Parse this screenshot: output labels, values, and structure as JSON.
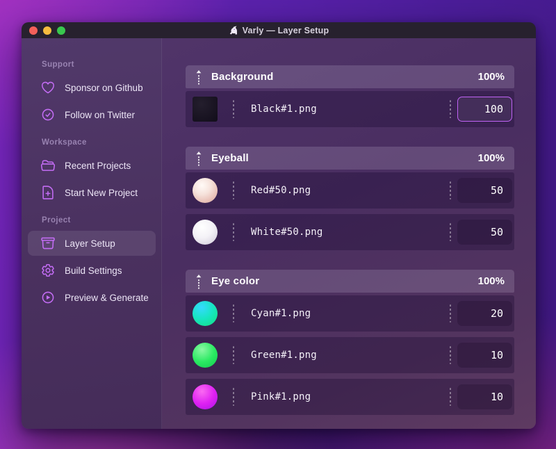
{
  "window": {
    "title": "Varly — Layer Setup"
  },
  "sidebar": {
    "sections": [
      {
        "label": "Support",
        "items": [
          {
            "label": "Sponsor on Github",
            "icon": "heart-icon"
          },
          {
            "label": "Follow on Twitter",
            "icon": "badge-check-icon"
          }
        ]
      },
      {
        "label": "Workspace",
        "items": [
          {
            "label": "Recent Projects",
            "icon": "folder-open-icon"
          },
          {
            "label": "Start New Project",
            "icon": "document-plus-icon"
          }
        ]
      },
      {
        "label": "Project",
        "items": [
          {
            "label": "Layer Setup",
            "icon": "archive-box-icon",
            "selected": true
          },
          {
            "label": "Build Settings",
            "icon": "gear-icon"
          },
          {
            "label": "Preview & Generate",
            "icon": "play-circle-icon"
          }
        ]
      }
    ]
  },
  "main": {
    "groups": [
      {
        "title": "Background",
        "percent": "100%",
        "rows": [
          {
            "filename": "Black#1.png",
            "value": "100",
            "variant": "black",
            "focused": true
          }
        ]
      },
      {
        "title": "Eyeball",
        "percent": "100%",
        "rows": [
          {
            "filename": "Red#50.png",
            "value": "50",
            "variant": "red"
          },
          {
            "filename": "White#50.png",
            "value": "50",
            "variant": "white"
          }
        ]
      },
      {
        "title": "Eye color",
        "percent": "100%",
        "rows": [
          {
            "filename": "Cyan#1.png",
            "value": "20",
            "variant": "cyan"
          },
          {
            "filename": "Green#1.png",
            "value": "10",
            "variant": "green"
          },
          {
            "filename": "Pink#1.png",
            "value": "10",
            "variant": "pink"
          }
        ]
      }
    ]
  },
  "colors": {
    "accent": "#c36cf4",
    "focus_border": "#c062f5",
    "titlebar_bg": "#27212e",
    "traffic_red": "#f4605a",
    "traffic_yellow": "#f6bc3f",
    "traffic_green": "#39c74e"
  }
}
